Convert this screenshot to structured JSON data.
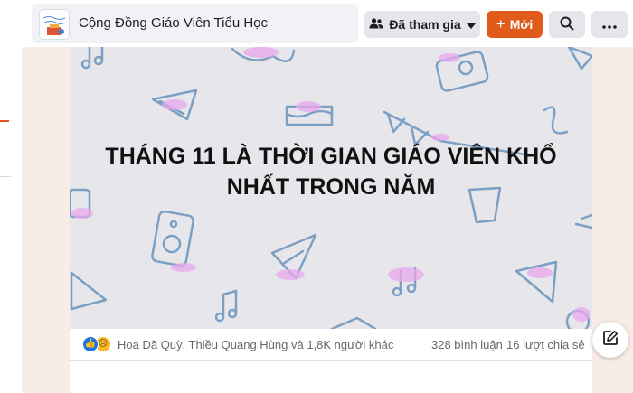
{
  "header": {
    "group_name": "Cộng Đồng Giáo Viên Tiểu Học",
    "joined_label": "Đã tham gia",
    "new_label": "Mới",
    "avatar_icon": "group-avatar-image",
    "search_icon": "search-icon",
    "more_icon": "more-dots-icon"
  },
  "post": {
    "banner_text": "THÁNG 11 LÀ THỜI GIAN GIÁO VIÊN KHỔ NHẤT TRONG NĂM",
    "banner_background": "#e7e7eb",
    "reactions_text": "Hoa Dã Quỳ, Thiều Quang Hùng và 1,8K người khác",
    "comments": "328 bình luận",
    "shares": "16 lượt chia sẻ",
    "reaction_icons": [
      "like-icon",
      "sad-icon"
    ]
  },
  "colors": {
    "accent": "#e05a1a",
    "page_background": "#f7ece6",
    "like_blue": "#1b74e4"
  },
  "fab_icon": "compose-icon"
}
